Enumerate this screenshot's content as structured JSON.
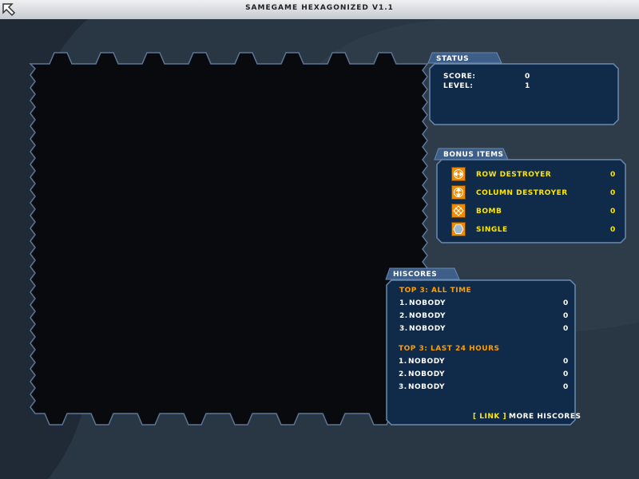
{
  "window": {
    "title": "SAMEGAME HEXAGONIZED V1.1",
    "back_icon": "back-arrow-icon"
  },
  "colors": {
    "background": "#1f2a36",
    "board": "#080a0e",
    "panel_fill": "#102a4a",
    "panel_border": "#6a8ab0",
    "label_yellow": "#ffe600",
    "heading_orange": "#ff9d00",
    "icon_orange": "#f08a00"
  },
  "status": {
    "heading": "STATUS",
    "score_label": "SCORE:",
    "score_value": "0",
    "level_label": "LEVEL:",
    "level_value": "1"
  },
  "bonus": {
    "heading": "BONUS ITEMS",
    "items": [
      {
        "icon": "row-destroyer-icon",
        "label": "ROW DESTROYER",
        "value": "0"
      },
      {
        "icon": "column-destroyer-icon",
        "label": "COLUMN DESTROYER",
        "value": "0"
      },
      {
        "icon": "bomb-icon",
        "label": "BOMB",
        "value": "0"
      },
      {
        "icon": "single-icon",
        "label": "SINGLE",
        "value": "0"
      }
    ]
  },
  "hiscores": {
    "heading": "HISCORES",
    "all_time": {
      "title": "TOP 3: ALL TIME",
      "entries": [
        {
          "rank": "1.",
          "name": "NOBODY",
          "score": "0"
        },
        {
          "rank": "2.",
          "name": "NOBODY",
          "score": "0"
        },
        {
          "rank": "3.",
          "name": "NOBODY",
          "score": "0"
        }
      ]
    },
    "last_24": {
      "title": "TOP 3: LAST 24 HOURS",
      "entries": [
        {
          "rank": "1.",
          "name": "NOBODY",
          "score": "0"
        },
        {
          "rank": "2.",
          "name": "NOBODY",
          "score": "0"
        },
        {
          "rank": "3.",
          "name": "NOBODY",
          "score": "0"
        }
      ]
    },
    "link_label": "[ LINK ]",
    "more_label": "MORE HISCORES"
  }
}
